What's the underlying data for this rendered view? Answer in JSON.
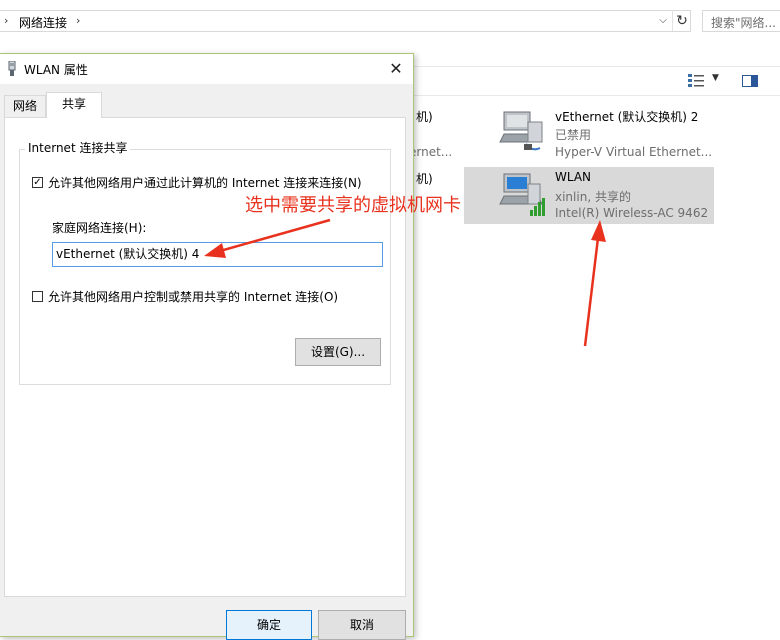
{
  "explorer": {
    "address_path": "网络连接",
    "search_placeholder": "搜索\"网络...",
    "partial_items": [
      {
        "line1": "机)",
        "line2": "ernet..."
      },
      {
        "line1": "机)"
      }
    ],
    "adapters": [
      {
        "name": "vEthernet (默认交换机) 2",
        "status": "已禁用",
        "device": "Hyper-V Virtual Ethernet..."
      },
      {
        "name": "WLAN",
        "status": "xinlin, 共享的",
        "device": "Intel(R) Wireless-AC 9462"
      }
    ]
  },
  "dialog": {
    "title": "WLAN 属性",
    "tabs": [
      "网络",
      "共享"
    ],
    "group_title": "Internet 连接共享",
    "allow_share_label": "允许其他网络用户通过此计算机的 Internet 连接来连接(N)",
    "allow_share_checked": true,
    "home_network_label": "家庭网络连接(H):",
    "home_network_value": "vEthernet (默认交换机) 4",
    "allow_control_label": "允许其他网络用户控制或禁用共享的 Internet 连接(O)",
    "allow_control_checked": false,
    "settings_button": "设置(G)...",
    "ok_button": "确定",
    "cancel_button": "取消"
  },
  "annotation": {
    "text": "选中需要共享的虚拟机网卡",
    "color": "#e8321e"
  },
  "colors": {
    "dialog_border": "#a9c777",
    "focus_blue": "#0078d7",
    "selected_item": "#d9d9d9"
  }
}
